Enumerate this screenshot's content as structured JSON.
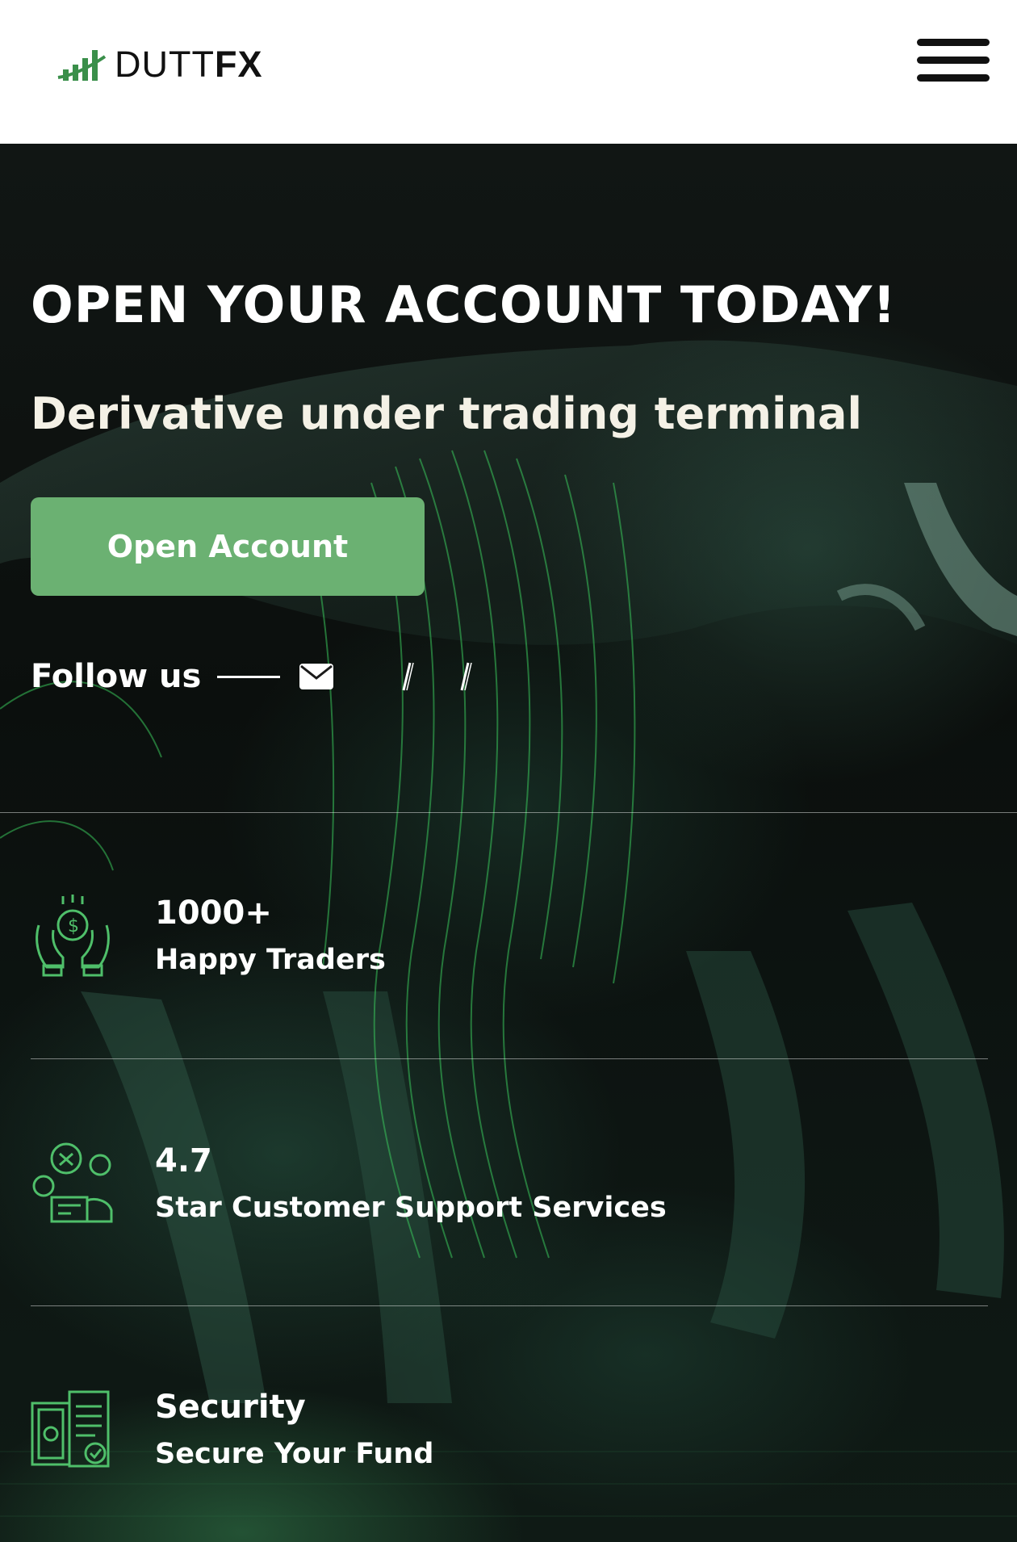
{
  "header": {
    "logo_text_light": "DUTT",
    "logo_text_bold": "FX",
    "logo_icon": "rising-bars-icon",
    "menu_icon": "hamburger-menu-icon"
  },
  "hero": {
    "title": "OPEN YOUR ACCOUNT TODAY!",
    "subtitle": "Derivative under trading terminal",
    "cta_label": "Open Account"
  },
  "follow": {
    "label": "Follow us",
    "icons": [
      "envelope-icon",
      "social-icon",
      "social-icon"
    ]
  },
  "stats": [
    {
      "value": "1000+",
      "label": "Happy Traders",
      "icon": "hands-money-icon"
    },
    {
      "value": "4.7",
      "label": "Star Customer Support Services",
      "icon": "customer-support-icon"
    },
    {
      "value": "Security",
      "label": "Secure Your Fund",
      "icon": "secure-document-icon"
    }
  ],
  "colors": {
    "accent": "#6bb172",
    "background": "#0a0d0b",
    "header": "#ffffff",
    "logo_green": "#3a8f4a"
  }
}
